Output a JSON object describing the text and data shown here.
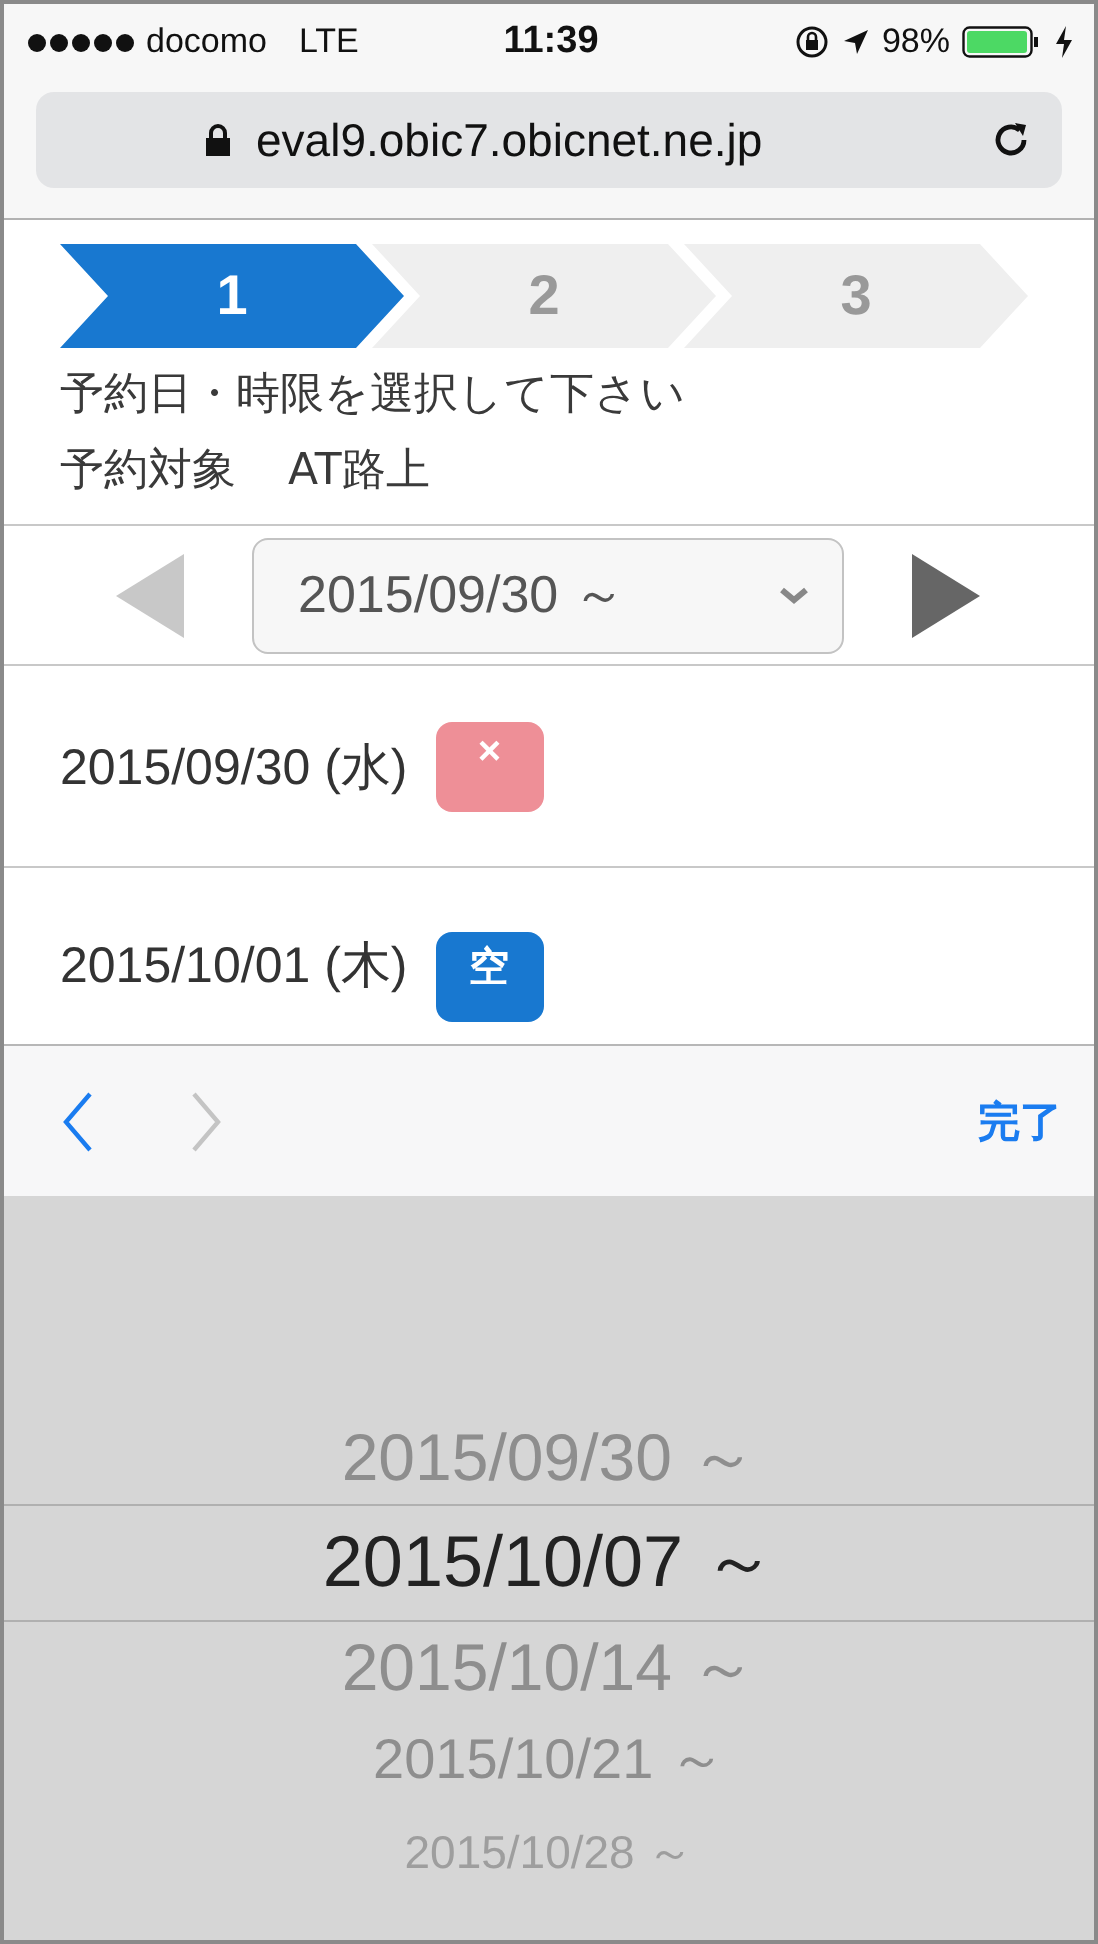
{
  "status_bar": {
    "carrier": "docomo",
    "network": "LTE",
    "time": "11:39",
    "battery": "98%"
  },
  "browser": {
    "url": "eval9.obic7.obicnet.ne.jp"
  },
  "steps": [
    {
      "label": "1",
      "selected": true
    },
    {
      "label": "2",
      "selected": false
    },
    {
      "label": "3",
      "selected": false
    }
  ],
  "instruction": "予約日・時限を選択して下さい",
  "target": {
    "label": "予約対象",
    "value": "AT路上"
  },
  "week_selector": {
    "value": "2015/09/30 ～",
    "prev_disabled": true,
    "next_disabled": false
  },
  "days": [
    {
      "date": "2015/09/30 (水)",
      "badge": "×",
      "kind": "full"
    },
    {
      "date": "2015/10/01 (木)",
      "badge": "空",
      "kind": "available"
    }
  ],
  "keyboard_toolbar": {
    "prev_disabled": false,
    "next_disabled": true,
    "done": "完了"
  },
  "picker": [
    {
      "label": "2015/09/30 ～",
      "selected": false
    },
    {
      "label": "2015/10/07 ～",
      "selected": true
    },
    {
      "label": "2015/10/14 ～",
      "selected": false
    },
    {
      "label": "2015/10/21 ～",
      "selected": false
    },
    {
      "label": "2015/10/28 ～",
      "selected": false
    }
  ]
}
